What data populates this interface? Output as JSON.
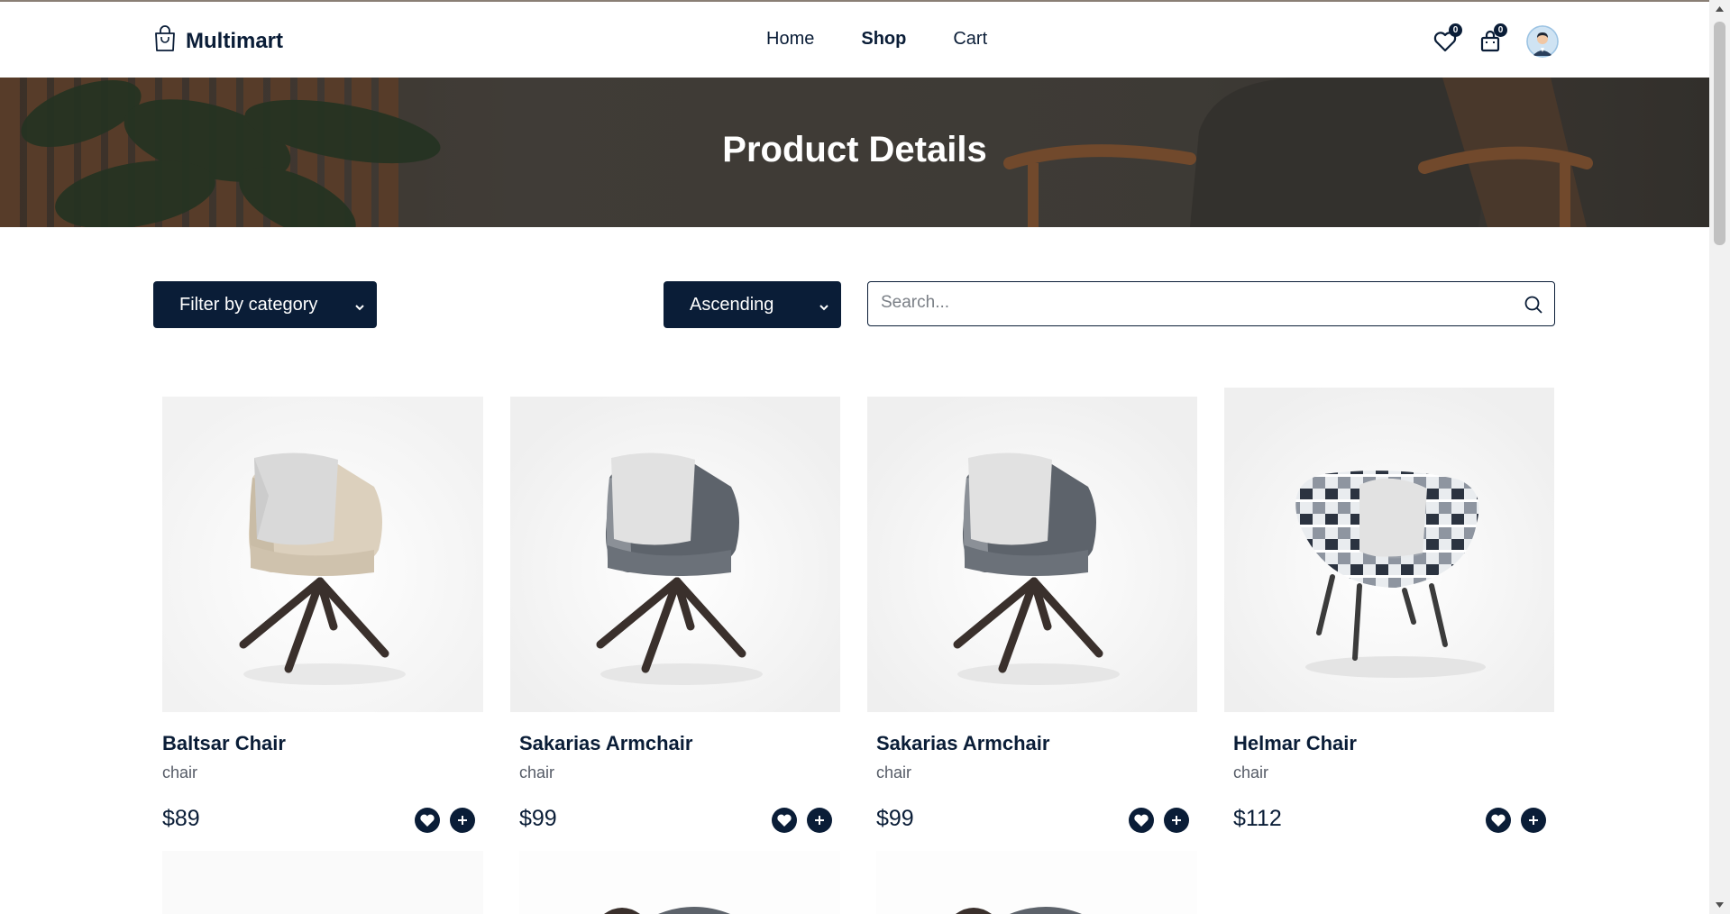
{
  "brand": {
    "name": "Multimart",
    "icon": "shopping-bag-icon"
  },
  "nav": {
    "home": "Home",
    "shop": "Shop",
    "cart": "Cart",
    "active": "Shop"
  },
  "header_icons": {
    "wishlist_count": "0",
    "cart_count": "0",
    "wishlist_icon": "heart-icon",
    "cart_icon": "bag-icon",
    "avatar_icon": "user-avatar"
  },
  "hero": {
    "title": "Product Details"
  },
  "filters": {
    "category_label": "Filter by category",
    "sort_label": "Ascending",
    "search_placeholder": "Search..."
  },
  "colors": {
    "primary": "#0a1d37",
    "hero_overlay": "#4c4640"
  },
  "products": [
    {
      "name": "Baltsar Chair",
      "category": "chair",
      "price": "$89",
      "variant": "beige"
    },
    {
      "name": "Sakarias Armchair",
      "category": "chair",
      "price": "$99",
      "variant": "grey"
    },
    {
      "name": "Sakarias Armchair",
      "category": "chair",
      "price": "$99",
      "variant": "grey"
    },
    {
      "name": "Helmar Chair",
      "category": "chair",
      "price": "$112",
      "variant": "plaid"
    }
  ]
}
